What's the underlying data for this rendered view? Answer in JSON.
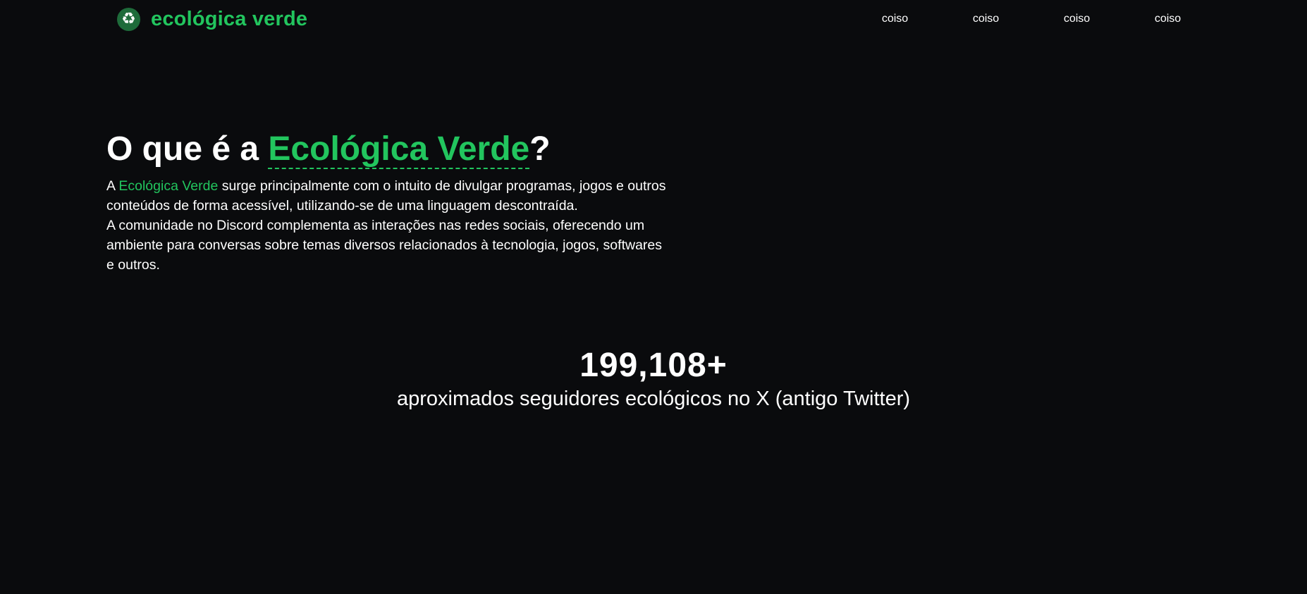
{
  "navbar": {
    "brand_icon": "recycle-icon",
    "brand_icon_glyph": "♻",
    "brand_name": "ecológica verde",
    "links": [
      "coiso",
      "coiso",
      "coiso",
      "coiso"
    ]
  },
  "about": {
    "title_prefix": "O que é a ",
    "title_highlight": "Ecológica Verde",
    "title_suffix": "?",
    "paragraph_prefix": "A ",
    "paragraph_highlight": "Ecológica Verde",
    "paragraph_rest": " surge principalmente com o intuito de divulgar programas, jogos e outros conteúdos de forma acessível, utilizando-se de uma linguagem descontraída.",
    "paragraph_2": "A comunidade no Discord complementa as interações nas redes sociais, oferecendo um ambiente para conversas sobre temas diversos relacionados à tecnologia, jogos, softwares e outros."
  },
  "stats": {
    "followers": "199,108+",
    "label": "aproximados seguidores ecológicos no X (antigo Twitter)"
  },
  "colors": {
    "background": "#0a0b0d",
    "accent": "#22c55e",
    "text": "#ffffff",
    "logo_background": "#1e6b3a"
  }
}
